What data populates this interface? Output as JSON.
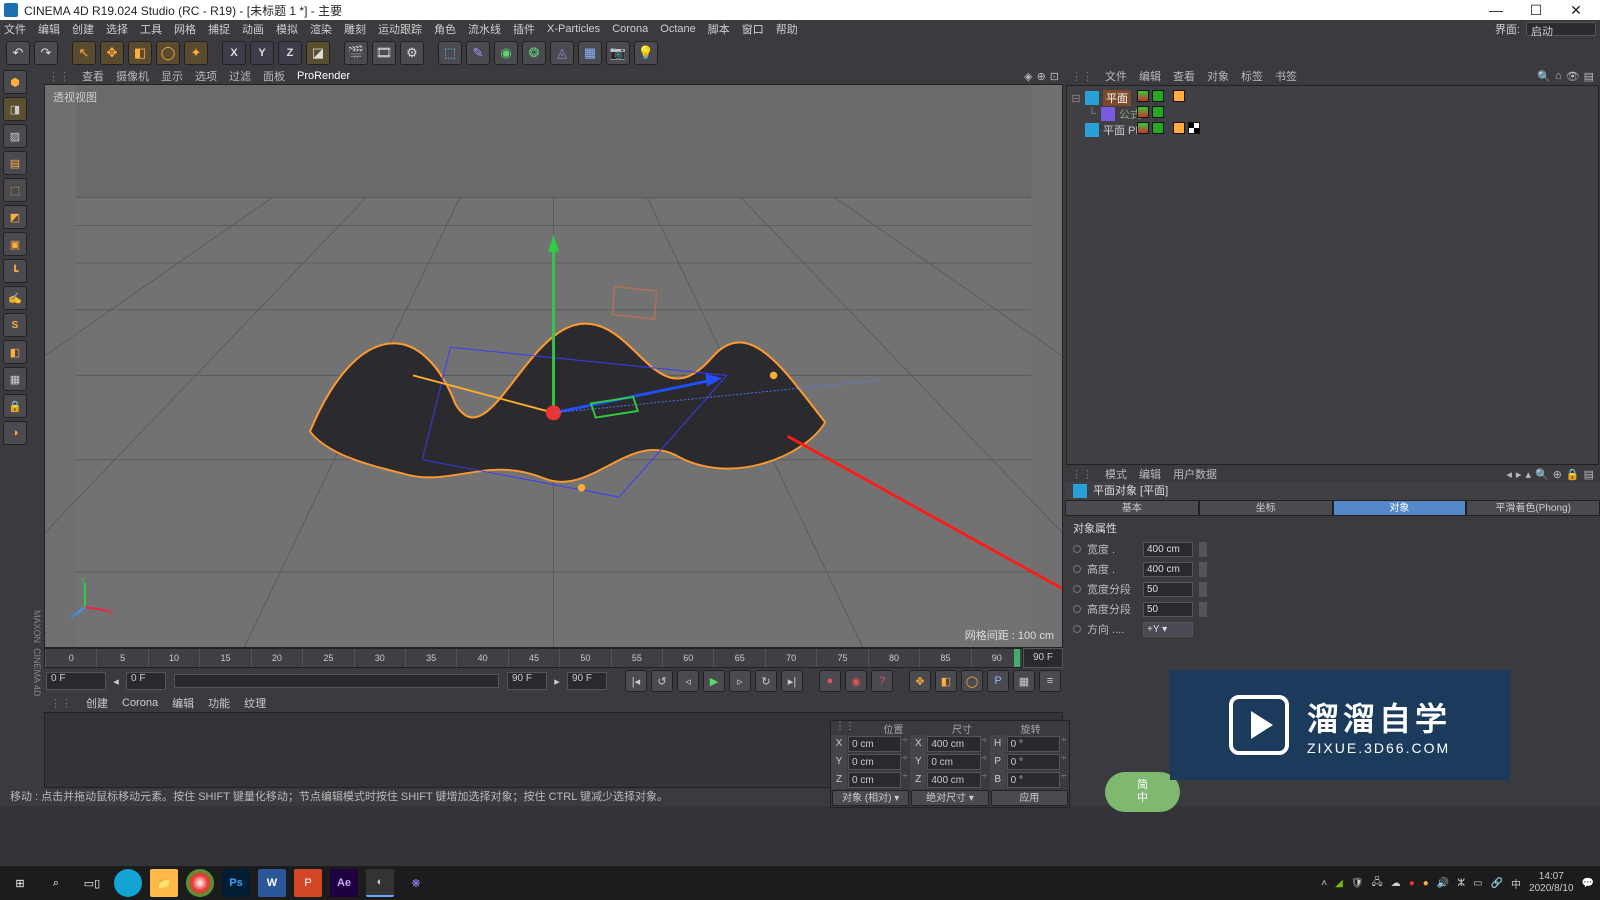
{
  "window": {
    "title": "CINEMA 4D R19.024 Studio (RC - R19) - [未标题 1 *] - 主要"
  },
  "menu": {
    "items": [
      "文件",
      "编辑",
      "创建",
      "选择",
      "工具",
      "网格",
      "捕捉",
      "动画",
      "模拟",
      "渲染",
      "雕刻",
      "运动跟踪",
      "角色",
      "流水线",
      "插件",
      "X-Particles",
      "Corona",
      "Octane",
      "脚本",
      "窗口",
      "帮助"
    ],
    "layout_label": "界面:",
    "layout_value": "启动"
  },
  "view_tabs": {
    "items": [
      "查看",
      "摄像机",
      "显示",
      "选项",
      "过滤",
      "面板",
      "ProRender"
    ],
    "active_index": 6
  },
  "viewport": {
    "label": "透视视图",
    "grid_label": "网格间距 :",
    "grid_value": "100 cm"
  },
  "timeline": {
    "start": 0,
    "end": 90,
    "ticks": [
      0,
      5,
      10,
      15,
      20,
      25,
      30,
      35,
      40,
      45,
      50,
      55,
      60,
      65,
      70,
      75,
      80,
      85,
      90
    ],
    "current": 90,
    "f_left": "0 F",
    "f_mid": "0 F",
    "f_r1": "90 F",
    "f_r2": "90 F"
  },
  "mat_tabs": {
    "items": [
      "创建",
      "Corona",
      "编辑",
      "功能",
      "纹理"
    ]
  },
  "coord": {
    "headers": [
      "位置",
      "尺寸",
      "旋转"
    ],
    "rows": [
      {
        "axis": "X",
        "pos": "0 cm",
        "size_lbl": "X",
        "size": "400 cm",
        "rot_lbl": "H",
        "rot": "0 °"
      },
      {
        "axis": "Y",
        "pos": "0 cm",
        "size_lbl": "Y",
        "size": "0 cm",
        "rot_lbl": "P",
        "rot": "0 °"
      },
      {
        "axis": "Z",
        "pos": "0 cm",
        "size_lbl": "Z",
        "size": "400 cm",
        "rot_lbl": "B",
        "rot": "0 °"
      }
    ],
    "mode1": "对象 (相对)",
    "mode2": "绝对尺寸",
    "apply": "应用"
  },
  "om_tabs": {
    "items": [
      "文件",
      "编辑",
      "查看",
      "对象",
      "标签",
      "书签"
    ]
  },
  "objects": [
    {
      "name": "平面",
      "indent": 0,
      "icon": "#28a0d8",
      "sel": true,
      "expandable": true
    },
    {
      "name": "公式",
      "indent": 1,
      "icon": "#7a5adf",
      "sel": false,
      "faded": true
    },
    {
      "name": "平面 PLA",
      "indent": 0,
      "icon": "#28a0d8",
      "sel": false
    }
  ],
  "attr_tabs": {
    "items": [
      "模式",
      "编辑",
      "用户数据"
    ]
  },
  "attr_title": {
    "icon": "#28a0d8",
    "text": "平面对象 [平面]"
  },
  "attr_subtabs": {
    "items": [
      "基本",
      "坐标",
      "对象",
      "平滑着色(Phong)"
    ],
    "active": 2
  },
  "attr_section_title": "对象属性",
  "attrs": [
    {
      "label": "宽度 .",
      "value": "400 cm"
    },
    {
      "label": "高度 .",
      "value": "400 cm"
    },
    {
      "label": "宽度分段",
      "value": "50"
    },
    {
      "label": "高度分段",
      "value": "50"
    },
    {
      "label": "方向 ....",
      "value": "+Y",
      "dropdown": true
    }
  ],
  "status": "移动 : 点击并拖动鼠标移动元素。按住 SHIFT 键量化移动；节点编辑模式时按住 SHIFT 键增加选择对象；按住 CTRL 键减少选择对象。",
  "watermark": {
    "big": "溜溜自学",
    "small": "ZIXUE.3D66.COM"
  },
  "pill": {
    "l1": "简",
    "l2": "中"
  },
  "clock": {
    "time": "14:07",
    "date": "2020/8/10"
  }
}
